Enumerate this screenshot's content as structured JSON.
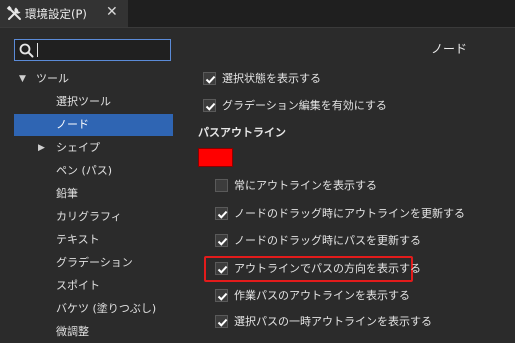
{
  "window": {
    "tab_label": "環境設定(P)",
    "close_glyph": "✕"
  },
  "search": {
    "value": "",
    "placeholder": ""
  },
  "tree": {
    "items": [
      {
        "label": "ツール",
        "arrow": "▼",
        "expanded": true
      },
      {
        "label": "選択ツール"
      },
      {
        "label": "ノード",
        "selected": true
      },
      {
        "label": "シェイプ",
        "arrow": "▶",
        "expanded": false
      },
      {
        "label": "ペン (パス)"
      },
      {
        "label": "鉛筆"
      },
      {
        "label": "カリグラフィ"
      },
      {
        "label": "テキスト"
      },
      {
        "label": "グラデーション"
      },
      {
        "label": "スポイト"
      },
      {
        "label": "バケツ (塗りつぶし)"
      },
      {
        "label": "微調整"
      }
    ]
  },
  "panel": {
    "title": "ノード",
    "options": [
      {
        "label": "選択状態を表示する",
        "checked": true
      },
      {
        "label": "グラデーション編集を有効にする",
        "checked": true
      }
    ],
    "outline_group": {
      "header": "パスアウトライン",
      "color": "#ff0000",
      "options": [
        {
          "label": "常にアウトラインを表示する",
          "checked": false
        },
        {
          "label": "ノードのドラッグ時にアウトラインを更新する",
          "checked": true
        },
        {
          "label": "ノードのドラッグ時にパスを更新する",
          "checked": true
        },
        {
          "label": "アウトラインでパスの方向を表示する",
          "checked": true,
          "highlighted": true
        },
        {
          "label": "作業パスのアウトラインを表示する",
          "checked": true
        },
        {
          "label": "選択パスの一時アウトラインを表示する",
          "checked": true
        }
      ]
    }
  },
  "colors": {
    "selection": "#2f65b3",
    "highlight": "#e31b1b",
    "search_border": "#5b8bd8"
  },
  "icons": {
    "tab": "tools-icon",
    "search": "search-icon",
    "check": "checkmark-icon"
  }
}
